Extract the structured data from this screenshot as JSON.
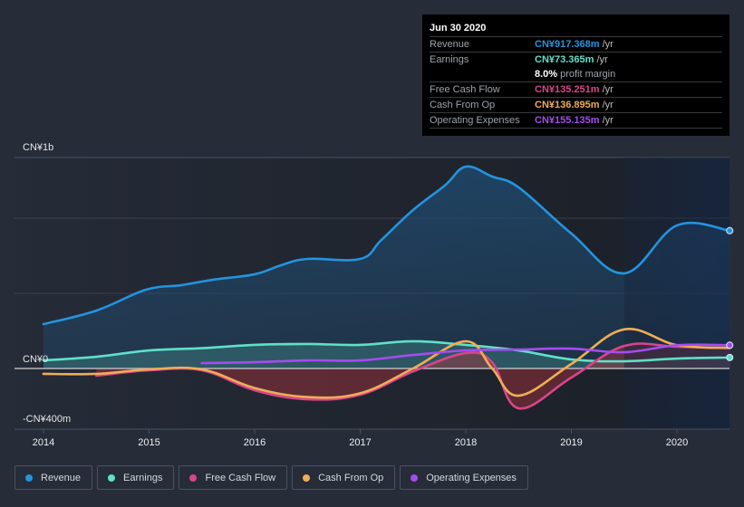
{
  "tooltip": {
    "date": "Jun 30 2020",
    "rows": [
      {
        "label": "Revenue",
        "value": "CN¥917.368m",
        "unit": "/yr",
        "color": "#2394df"
      },
      {
        "label": "Earnings",
        "value": "CN¥73.365m",
        "unit": "/yr",
        "color": "#5fe0c8"
      },
      {
        "label": "",
        "value": "8.0%",
        "unit": "profit margin",
        "color": "#ffffff"
      },
      {
        "label": "Free Cash Flow",
        "value": "CN¥135.251m",
        "unit": "/yr",
        "color": "#d8458a"
      },
      {
        "label": "Cash From Op",
        "value": "CN¥136.895m",
        "unit": "/yr",
        "color": "#f0ad56"
      },
      {
        "label": "Operating Expenses",
        "value": "CN¥155.135m",
        "unit": "/yr",
        "color": "#a54cf0"
      }
    ]
  },
  "legend": [
    {
      "label": "Revenue",
      "color": "#2394df"
    },
    {
      "label": "Earnings",
      "color": "#5fe0c8"
    },
    {
      "label": "Free Cash Flow",
      "color": "#d8458a"
    },
    {
      "label": "Cash From Op",
      "color": "#f0ad56"
    },
    {
      "label": "Operating Expenses",
      "color": "#a54cf0"
    }
  ],
  "chart_data": {
    "type": "line",
    "title": "",
    "xlabel": "",
    "ylabel": "",
    "y_tick_labels": [
      "CN¥1b",
      "CN¥0",
      "-CN¥400m"
    ],
    "x_tick_labels": [
      "2014",
      "2015",
      "2016",
      "2017",
      "2018",
      "2019",
      "2020"
    ],
    "x_range": [
      2014,
      2020.5
    ],
    "ylim_millions": [
      -400,
      1400
    ],
    "highlight_from": 2019.5,
    "grid": true,
    "legend_position": "bottom-left",
    "series": [
      {
        "name": "Revenue",
        "color": "#2394df",
        "area": true,
        "x": [
          2014.0,
          2014.5,
          2014.97,
          2015.3,
          2015.6,
          2016.0,
          2016.25,
          2016.5,
          2017.0,
          2017.2,
          2017.5,
          2017.8,
          2018.0,
          2018.25,
          2018.5,
          2019.0,
          2019.5,
          2020.0,
          2020.5
        ],
        "y": [
          295,
          385,
          524,
          554,
          590,
          627,
          687,
          729,
          729,
          855,
          1054,
          1217,
          1343,
          1277,
          1205,
          898,
          633,
          952,
          917
        ]
      },
      {
        "name": "Earnings",
        "color": "#5fe0c8",
        "area": true,
        "x": [
          2014.0,
          2014.5,
          2015.0,
          2015.5,
          2016.0,
          2016.5,
          2017.0,
          2017.5,
          2018.0,
          2018.5,
          2019.0,
          2019.5,
          2020.0,
          2020.5
        ],
        "y": [
          54,
          78,
          120,
          135,
          157,
          163,
          157,
          181,
          157,
          120,
          60,
          48,
          66,
          73
        ]
      },
      {
        "name": "Free Cash Flow",
        "color": "#d8458a",
        "area": true,
        "x": [
          2014.5,
          2015.0,
          2015.5,
          2016.0,
          2016.5,
          2017.0,
          2017.5,
          2018.0,
          2018.25,
          2018.5,
          2019.0,
          2019.5,
          2020.0,
          2020.5
        ],
        "y": [
          -48,
          -12,
          -12,
          -145,
          -205,
          -175,
          -20,
          102,
          40,
          -265,
          -60,
          150,
          145,
          135
        ]
      },
      {
        "name": "Cash From Op",
        "color": "#f0ad56",
        "area": false,
        "x": [
          2014.0,
          2014.5,
          2015.0,
          2015.5,
          2016.0,
          2016.5,
          2017.0,
          2017.5,
          2018.0,
          2018.25,
          2018.5,
          2019.0,
          2019.5,
          2020.0,
          2020.5
        ],
        "y": [
          -36,
          -36,
          -6,
          -6,
          -130,
          -190,
          -165,
          0,
          181,
          0,
          -181,
          30,
          260,
          155,
          137
        ]
      },
      {
        "name": "Operating Expenses",
        "color": "#a54cf0",
        "area": false,
        "x": [
          2015.5,
          2016.0,
          2016.5,
          2017.0,
          2017.5,
          2018.0,
          2018.5,
          2019.0,
          2019.5,
          2020.0,
          2020.5
        ],
        "y": [
          36,
          42,
          54,
          54,
          90,
          120,
          126,
          132,
          108,
          155,
          155
        ]
      }
    ]
  }
}
